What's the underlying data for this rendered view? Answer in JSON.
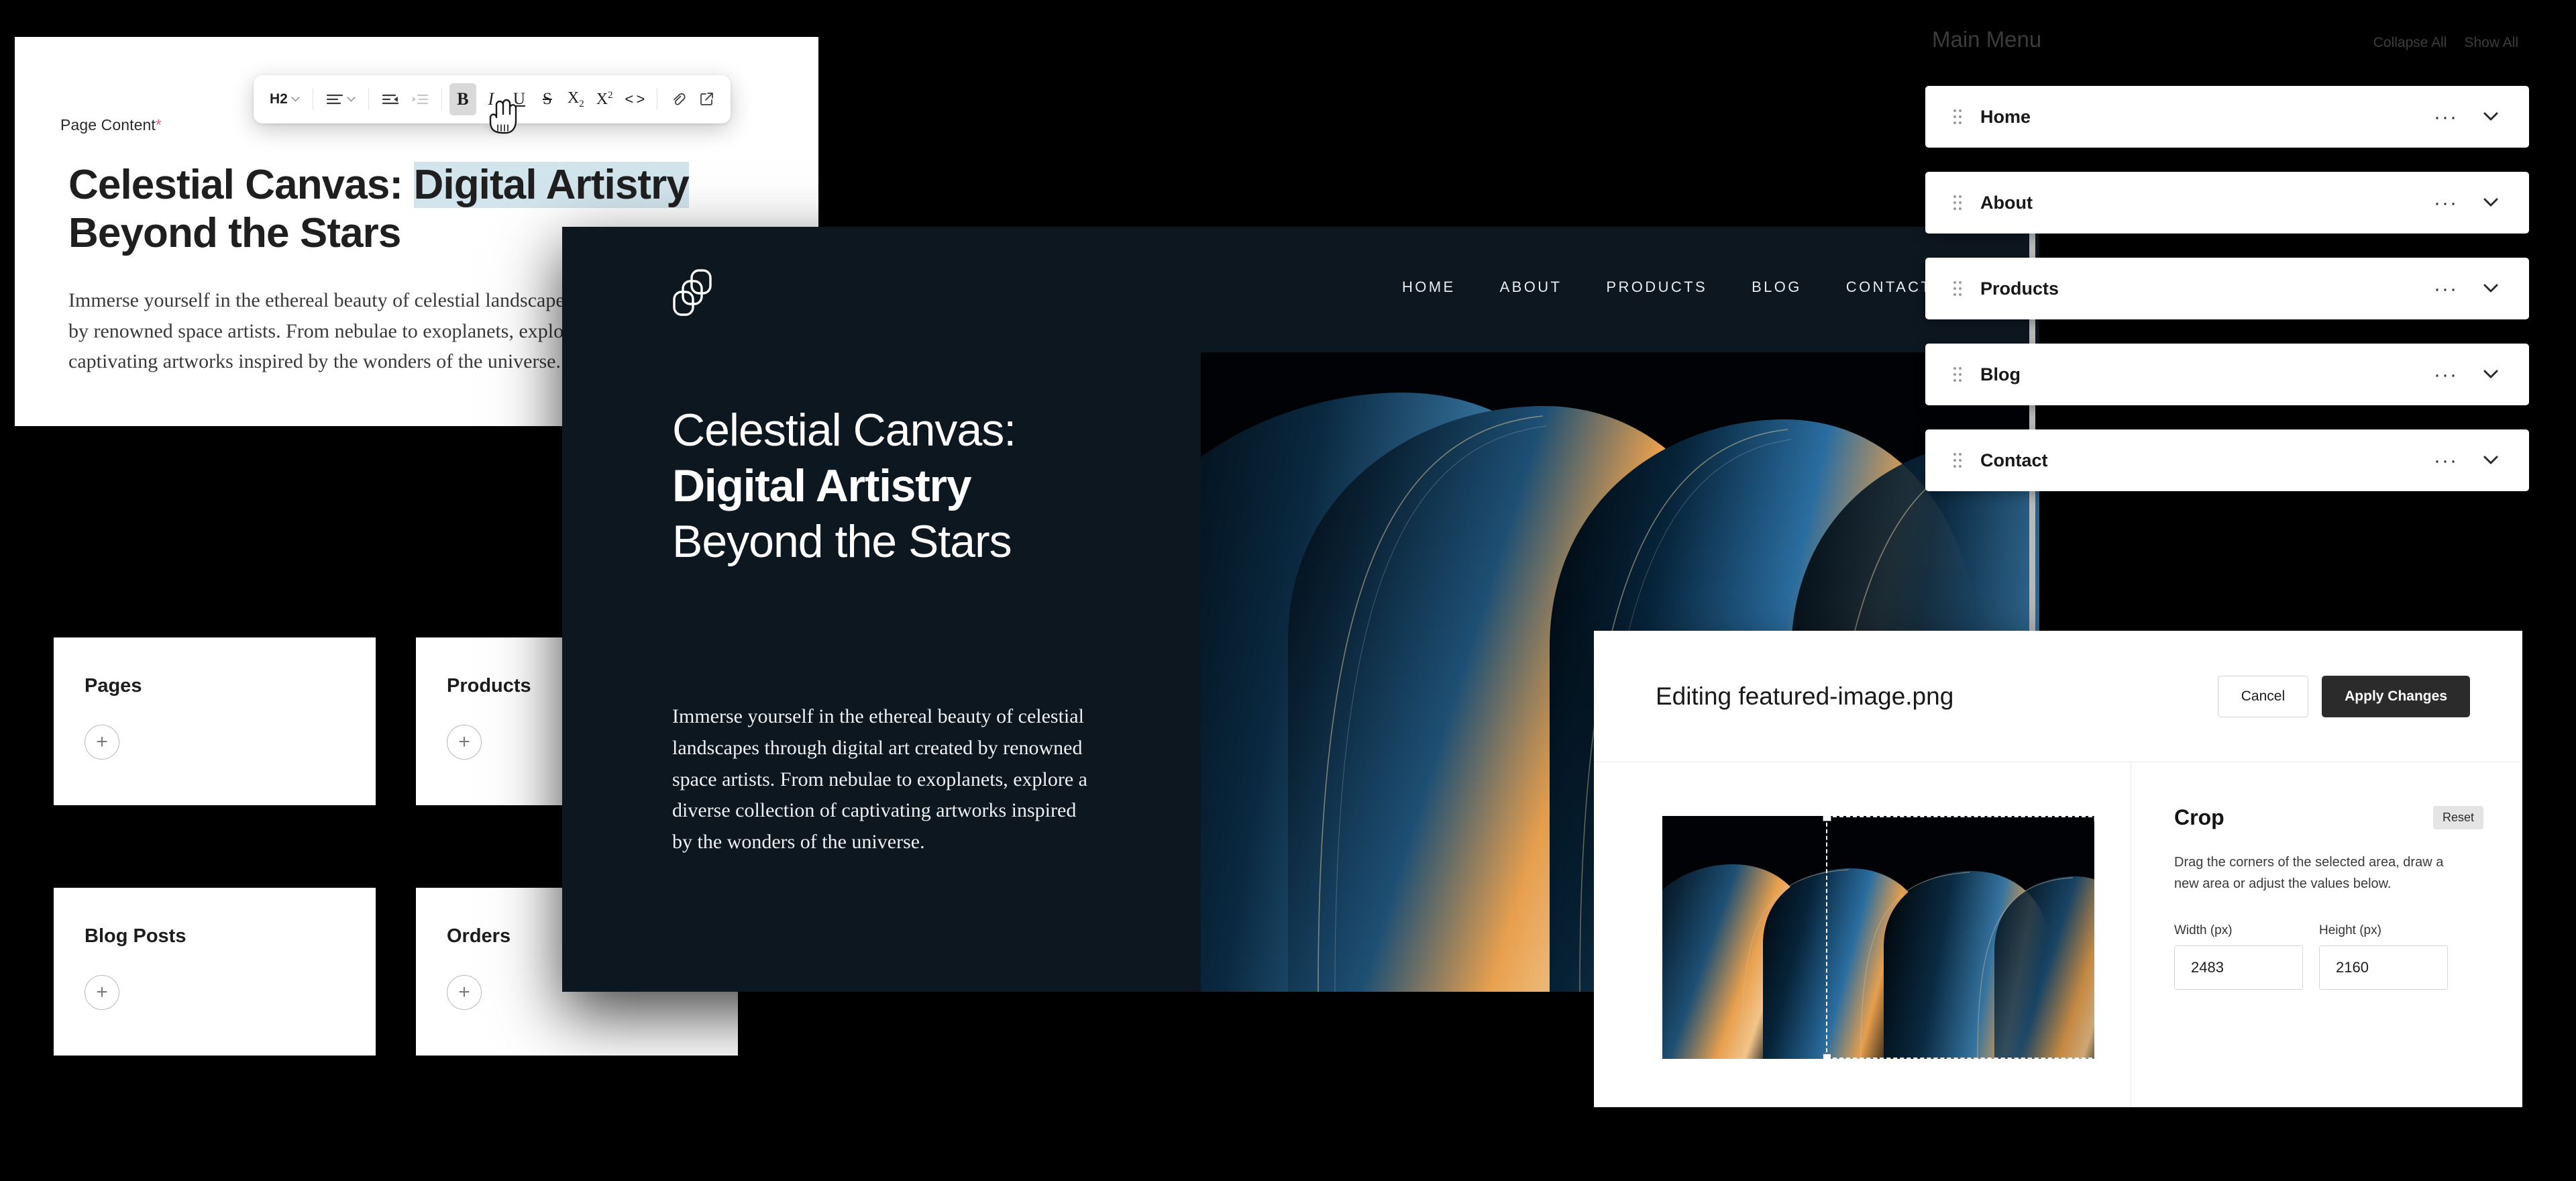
{
  "editor": {
    "field_label": "Page Content",
    "required_mark": "*",
    "heading_prefix": "Celestial Canvas: ",
    "heading_selected": "Digital Artistry",
    "heading_line2": "Beyond the Stars",
    "body": "Immerse yourself in the ethereal beauty of celestial landscapes through digital art created by renowned space artists. From nebulae to exoplanets, explore a diverse collection of captivating artworks inspired by the wonders of the universe."
  },
  "toolbar": {
    "block_style": "H2",
    "items": [
      {
        "name": "heading-level-select",
        "label": "H2",
        "icon": "chevron-down-icon",
        "state": "default"
      },
      {
        "name": "align-left-button",
        "label": "",
        "icon": "align-left-icon",
        "state": "default"
      },
      {
        "name": "outdent-button",
        "label": "",
        "icon": "outdent-icon",
        "state": "default"
      },
      {
        "name": "indent-button",
        "label": "",
        "icon": "indent-icon",
        "state": "disabled"
      },
      {
        "name": "bold-button",
        "label": "B",
        "icon": "bold-icon",
        "state": "active"
      },
      {
        "name": "italic-button",
        "label": "I",
        "icon": "italic-icon",
        "state": "default"
      },
      {
        "name": "underline-button",
        "label": "U",
        "icon": "underline-icon",
        "state": "default"
      },
      {
        "name": "strikethrough-button",
        "label": "S",
        "icon": "strikethrough-icon",
        "state": "default"
      },
      {
        "name": "subscript-button",
        "label": "X2",
        "icon": "subscript-icon",
        "state": "default"
      },
      {
        "name": "superscript-button",
        "label": "X2",
        "icon": "superscript-icon",
        "state": "default"
      },
      {
        "name": "code-button",
        "label": "<>",
        "icon": "code-icon",
        "state": "default"
      },
      {
        "name": "link-button",
        "label": "",
        "icon": "link-icon",
        "state": "default"
      },
      {
        "name": "external-link-button",
        "label": "",
        "icon": "external-link-icon",
        "state": "default"
      }
    ],
    "code_label": "< >",
    "bold_label": "B",
    "italic_label": "I",
    "underline_label": "U",
    "strike_label": "S",
    "sub_base": "X",
    "sub_script": "2",
    "sup_base": "X",
    "sup_script": "2"
  },
  "dashboard": {
    "cards": [
      {
        "title": "Pages",
        "add_label": "+"
      },
      {
        "title": "Products",
        "add_label": "+"
      },
      {
        "title": "Blog Posts",
        "add_label": "+"
      },
      {
        "title": "Orders",
        "add_label": "+"
      }
    ]
  },
  "site_preview": {
    "logo_name": "overlapping-squares-logo",
    "nav": [
      "HOME",
      "ABOUT",
      "PRODUCTS",
      "BLOG",
      "CONTACT"
    ],
    "hero_line1": "Celestial Canvas:",
    "hero_line2": "Digital Artistry",
    "hero_line3": "Beyond the Stars",
    "hero_paragraph": "Immerse yourself in the ethereal beauty of celestial landscapes through digital art created by renowned space artists. From nebulae to exoplanets, explore a diverse collection of captivating artworks inspired by the wonders of the universe.",
    "artwork_name": "abstract-arcs-artwork"
  },
  "main_menu": {
    "title": "Main Menu",
    "collapse_all": "Collapse All",
    "show_all": "Show All",
    "items": [
      {
        "label": "Home"
      },
      {
        "label": "About"
      },
      {
        "label": "Products"
      },
      {
        "label": "Blog"
      },
      {
        "label": "Contact"
      }
    ],
    "more_glyph": "···"
  },
  "edit_dialog": {
    "title": "Editing featured-image.png",
    "cancel_label": "Cancel",
    "apply_label": "Apply Changes",
    "crop": {
      "heading": "Crop",
      "reset_label": "Reset",
      "description": "Drag the corners of the selected area, draw a new area or adjust the values below.",
      "width_label": "Width (px)",
      "width_value": "2483",
      "height_label": "Height (px)",
      "height_value": "2160"
    }
  },
  "colors": {
    "page_background": "#000000",
    "preview_background": "#0d1720",
    "selection_highlight": "#d2e4ec",
    "required_asterisk": "#e8607f",
    "apply_button": "#2b2b2b",
    "artwork_accent": "#e8a04e"
  }
}
